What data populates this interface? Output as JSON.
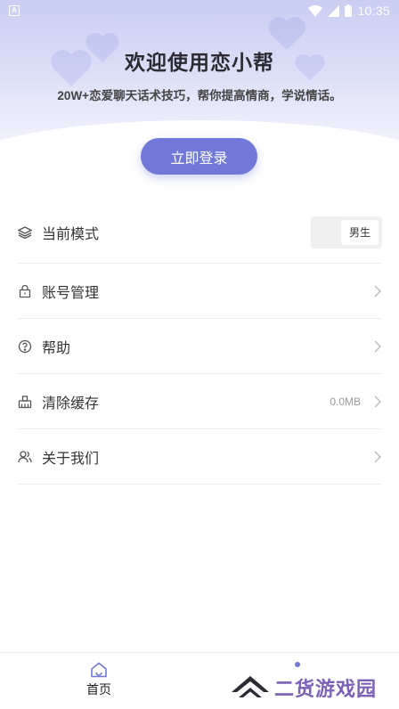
{
  "status_bar": {
    "time": "10:35",
    "icons": [
      "notification-a-icon",
      "wifi-icon",
      "signal-icon",
      "battery-icon"
    ]
  },
  "header": {
    "title": "欢迎使用恋小帮",
    "subtitle": "20W+恋爱聊天话术技巧，帮你提高情商，学说情话。",
    "login_label": "立即登录"
  },
  "menu": {
    "items": [
      {
        "label": "当前模式",
        "icon": "layers-icon",
        "toggle_value": "男生"
      },
      {
        "label": "账号管理",
        "icon": "lock-icon"
      },
      {
        "label": "帮助",
        "icon": "help-circle-icon"
      },
      {
        "label": "清除缓存",
        "icon": "broom-icon",
        "value": "0.0MB"
      },
      {
        "label": "关于我们",
        "icon": "users-icon"
      }
    ]
  },
  "bottom_nav": {
    "home_label": "首页"
  },
  "watermark": {
    "text": "二货游戏园"
  },
  "colors": {
    "accent": "#7179d8",
    "header_gradient_top": "#c9cdf1",
    "watermark": "#7b62b8"
  }
}
